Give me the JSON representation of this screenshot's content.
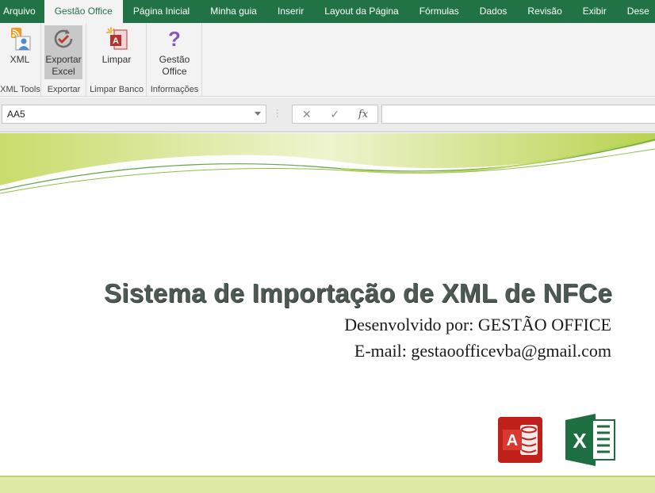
{
  "tabs": [
    "Arquivo",
    "Gestão Office",
    "Página Inicial",
    "Minha guia",
    "Inserir",
    "Layout da Página",
    "Fórmulas",
    "Dados",
    "Revisão",
    "Exibir",
    "Dese"
  ],
  "active_tab": "Gestão Office",
  "ribbon": {
    "groups": [
      {
        "label": "XML Tools",
        "buttons": [
          {
            "label": "XML",
            "icon": "rss-user-icon"
          }
        ]
      },
      {
        "label": "Exportar",
        "buttons": [
          {
            "label": "Exportar\nExcel",
            "icon": "refresh-check-icon",
            "selected": true
          }
        ]
      },
      {
        "label": "Limpar Banco",
        "buttons": [
          {
            "label": "Limpar",
            "icon": "access-clear-icon"
          }
        ]
      },
      {
        "label": "Informações",
        "buttons": [
          {
            "label": "Gestão\nOffice",
            "icon": "question-icon"
          }
        ]
      }
    ]
  },
  "formula_bar": {
    "name_box": "AA5",
    "formula": ""
  },
  "sheet": {
    "title": "Sistema de Importação de XML de NFCe",
    "developer": "Desenvolvido por: GESTÃO OFFICE",
    "email": "E-mail: gestaoofficevba@gmail.com",
    "logo_access_letter": "A",
    "logo_excel_letter": "X"
  },
  "colors": {
    "tab_bar": "#217346",
    "accent_green": "#a8c83c",
    "title": "#4f5a55"
  }
}
